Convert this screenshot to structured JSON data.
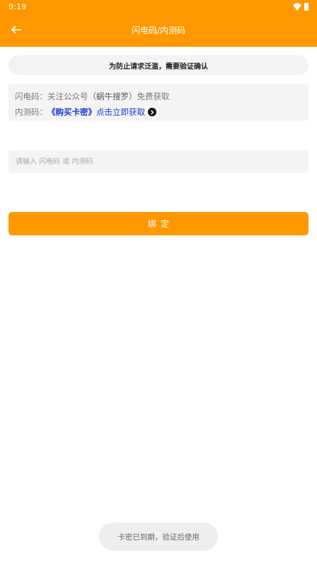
{
  "status_bar": {
    "time": "9:19",
    "icons": [
      "wifi-icon",
      "battery-icon"
    ]
  },
  "header": {
    "back_icon": "arrow-left-icon",
    "title": "闪电码/内测码"
  },
  "notice": {
    "text": "为防止请求泛滥，需要验证确认"
  },
  "info": {
    "line1_prefix": "闪电码：关注公众号",
    "line1_paren": "（蜗牛搜罗）",
    "line1_suffix": "免费获取",
    "line2_prefix": "内测码：",
    "line2_link": "《购买卡密》",
    "line2_action": "点击立即获取",
    "line2_icon": "chevron-right-circle-icon"
  },
  "input": {
    "value": "",
    "placeholder": "请输入 闪电码 或 内测码"
  },
  "bind_button": {
    "label": "绑定"
  },
  "toast": {
    "text": "卡密已到期，验证后使用"
  },
  "colors": {
    "accent": "#FF9800",
    "link": "#1a3bd1"
  }
}
